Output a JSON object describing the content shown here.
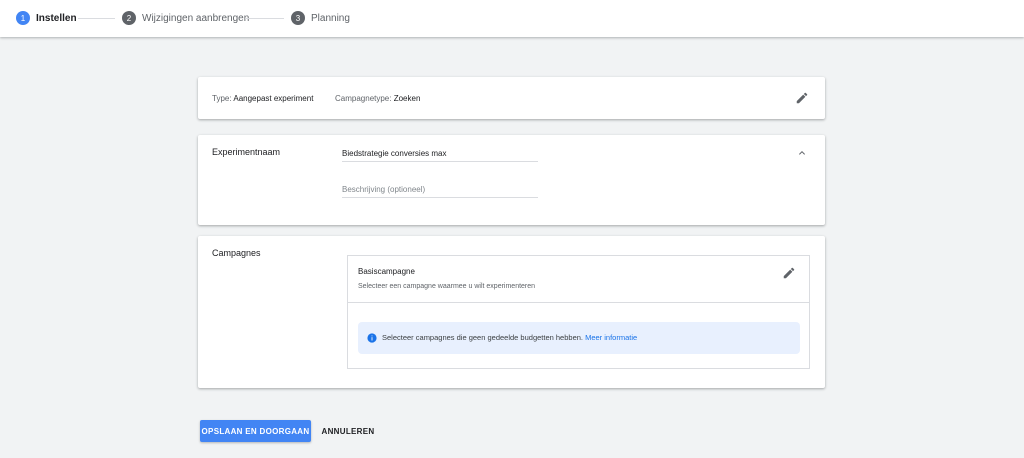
{
  "stepper": {
    "steps": [
      {
        "number": "1",
        "label": "Instellen"
      },
      {
        "number": "2",
        "label": "Wijzigingen aanbrengen"
      },
      {
        "number": "3",
        "label": "Planning"
      }
    ]
  },
  "summary": {
    "type_label": "Type:",
    "type_value": "Aangepast experiment",
    "campaign_type_label": "Campagnetype:",
    "campaign_type_value": "Zoeken"
  },
  "experiment": {
    "title": "Experimentnaam",
    "name_value": "Biedstrategie conversies max",
    "description_placeholder": "Beschrijving (optioneel)"
  },
  "campaigns": {
    "title": "Campagnes",
    "base_title": "Basiscampagne",
    "base_subtitle": "Selecteer een campagne waarmee u wilt experimenteren",
    "notice_text": "Selecteer campagnes die geen gedeelde budgetten hebben.",
    "notice_link": "Meer informatie"
  },
  "actions": {
    "save_label": "OPSLAAN EN DOORGAAN",
    "cancel_label": "ANNULEREN"
  },
  "colors": {
    "accent": "#4285f4",
    "link": "#1a73e8",
    "notice_bg": "#e8f0fe"
  }
}
